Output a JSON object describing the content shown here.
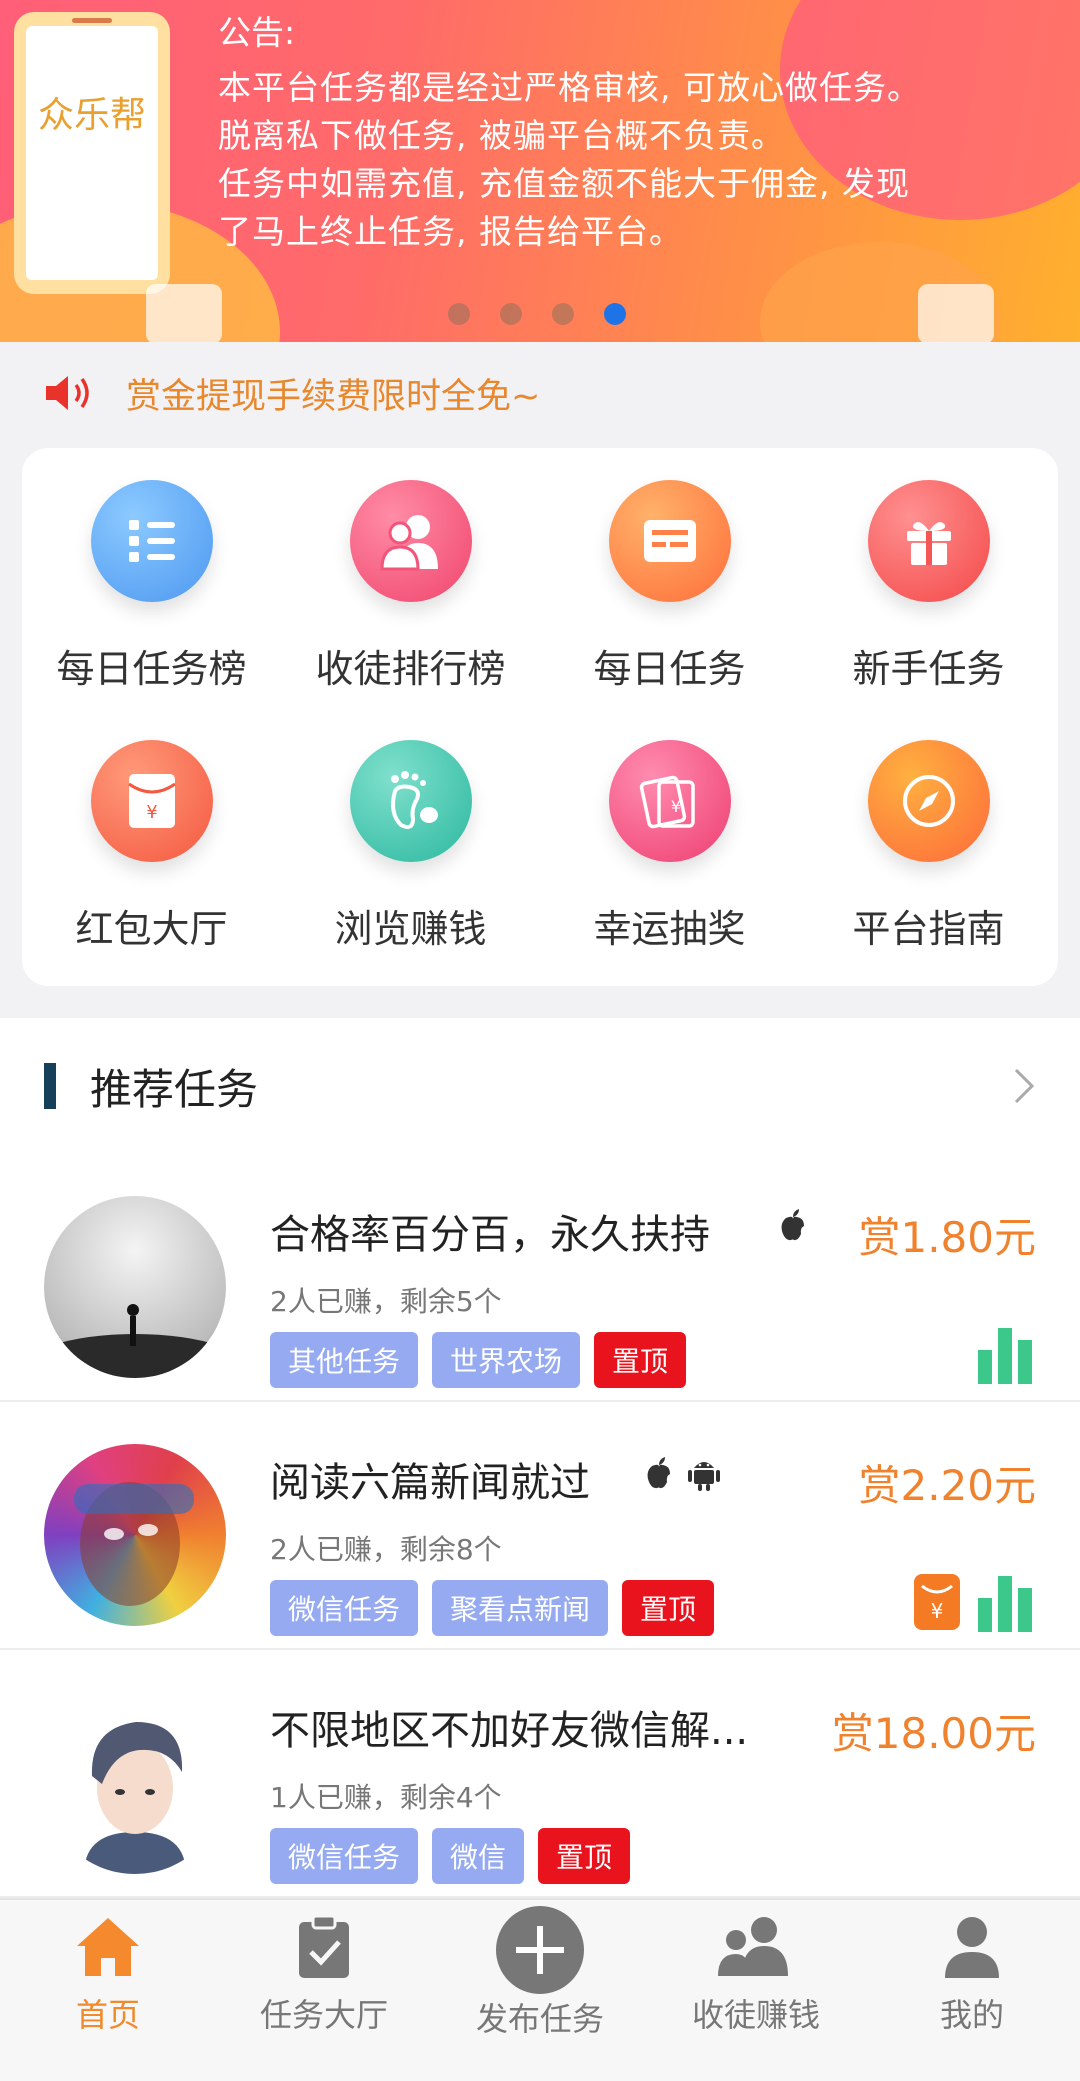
{
  "banner": {
    "brand": "众乐帮",
    "notice_title": "公告:",
    "notice_lines": [
      "本平台任务都是经过严格审核, 可放心做任务。",
      "脱离私下做任务, 被骗平台概不负责。",
      "任务中如需充值, 充值金额不能大于佣金, 发现",
      "了马上终止任务, 报告给平台。"
    ],
    "carousel_pages": 4,
    "carousel_active": 4
  },
  "announcement": "赏金提现手续费限时全免~",
  "menu": [
    {
      "label": "每日任务榜",
      "icon": "task-list-icon",
      "color": "#5aa8f5"
    },
    {
      "label": "收徒排行榜",
      "icon": "users-icon",
      "color": "#f5557a"
    },
    {
      "label": "每日任务",
      "icon": "card-icon",
      "color": "#ff8a4a"
    },
    {
      "label": "新手任务",
      "icon": "gift-icon",
      "color": "#fb5a5a"
    },
    {
      "label": "红包大厅",
      "icon": "red-envelope-icon",
      "color": "#fb6a4a"
    },
    {
      "label": "浏览赚钱",
      "icon": "footprint-icon",
      "color": "#3dc5b0"
    },
    {
      "label": "幸运抽奖",
      "icon": "lottery-icon",
      "color": "#f45a82"
    },
    {
      "label": "平台指南",
      "icon": "compass-icon",
      "color": "#fc8a3c"
    }
  ],
  "recommend": {
    "title": "推荐任务",
    "tasks": [
      {
        "title": "合格率百分百，永久扶持",
        "os": [
          "apple"
        ],
        "reward": "赏1.80元",
        "meta": "2人已赚，剩余5个",
        "tags": [
          "其他任务",
          "世界农场",
          "置顶"
        ],
        "badges": [
          "chart"
        ]
      },
      {
        "title": "阅读六篇新闻就过",
        "os": [
          "apple",
          "android"
        ],
        "reward": "赏2.20元",
        "meta": "2人已赚，剩余8个",
        "tags": [
          "微信任务",
          "聚看点新闻",
          "置顶"
        ],
        "badges": [
          "money",
          "chart"
        ]
      },
      {
        "title": "不限地区不加好友微信解...",
        "os": [],
        "reward": "赏18.00元",
        "meta": "1人已赚，剩余4个",
        "tags": [
          "微信任务",
          "微信",
          "置顶"
        ],
        "badges": []
      }
    ]
  },
  "nav": [
    {
      "label": "首页",
      "icon": "home-icon",
      "active": true
    },
    {
      "label": "任务大厅",
      "icon": "clipboard-icon",
      "active": false
    },
    {
      "label": "发布任务",
      "icon": "plus-circle-icon",
      "active": false
    },
    {
      "label": "收徒赚钱",
      "icon": "group-icon",
      "active": false
    },
    {
      "label": "我的",
      "icon": "person-icon",
      "active": false
    }
  ],
  "colors": {
    "accent": "#f0822e",
    "tag": "#96aaf2",
    "top_tag": "#e8131d",
    "chart_green": "#3cc88a"
  }
}
